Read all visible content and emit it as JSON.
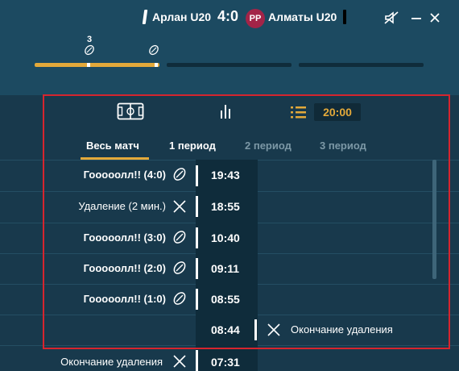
{
  "header": {
    "home_team": "Арлан U20",
    "score": "4:0",
    "badge": "РР",
    "away_team": "Алматы U20",
    "icons": [
      "mute-icon",
      "minimize-icon",
      "close-icon"
    ]
  },
  "timeline": {
    "goal_count_label": "3"
  },
  "tabs": {
    "timer": "20:00",
    "icons": [
      "field-icon",
      "stats-icon",
      "list-icon"
    ]
  },
  "periods": [
    "Весь матч",
    "1 период",
    "2 период",
    "3 период"
  ],
  "events": [
    {
      "side": "home",
      "label": "Гооооолл!! (4:0)",
      "time": "19:43",
      "icon": "puck-icon"
    },
    {
      "side": "home",
      "label": "Удаление (2 мин.)",
      "time": "18:55",
      "icon": "penalty-x-icon"
    },
    {
      "side": "home",
      "label": "Гооооолл!! (3:0)",
      "time": "10:40",
      "icon": "puck-icon"
    },
    {
      "side": "home",
      "label": "Гооооолл!! (2:0)",
      "time": "09:11",
      "icon": "puck-icon"
    },
    {
      "side": "home",
      "label": "Гооооолл!! (1:0)",
      "time": "08:55",
      "icon": "puck-icon"
    },
    {
      "side": "away",
      "label": "Окончание удаления",
      "time": "08:44",
      "icon": "penalty-x-icon"
    },
    {
      "side": "home",
      "label": "Окончание удаления",
      "time": "07:31",
      "icon": "penalty-x-icon"
    }
  ],
  "colors": {
    "accent": "#e3a93a",
    "badge": "#a32448",
    "highlight": "#d6252e",
    "background": "#18394c"
  }
}
